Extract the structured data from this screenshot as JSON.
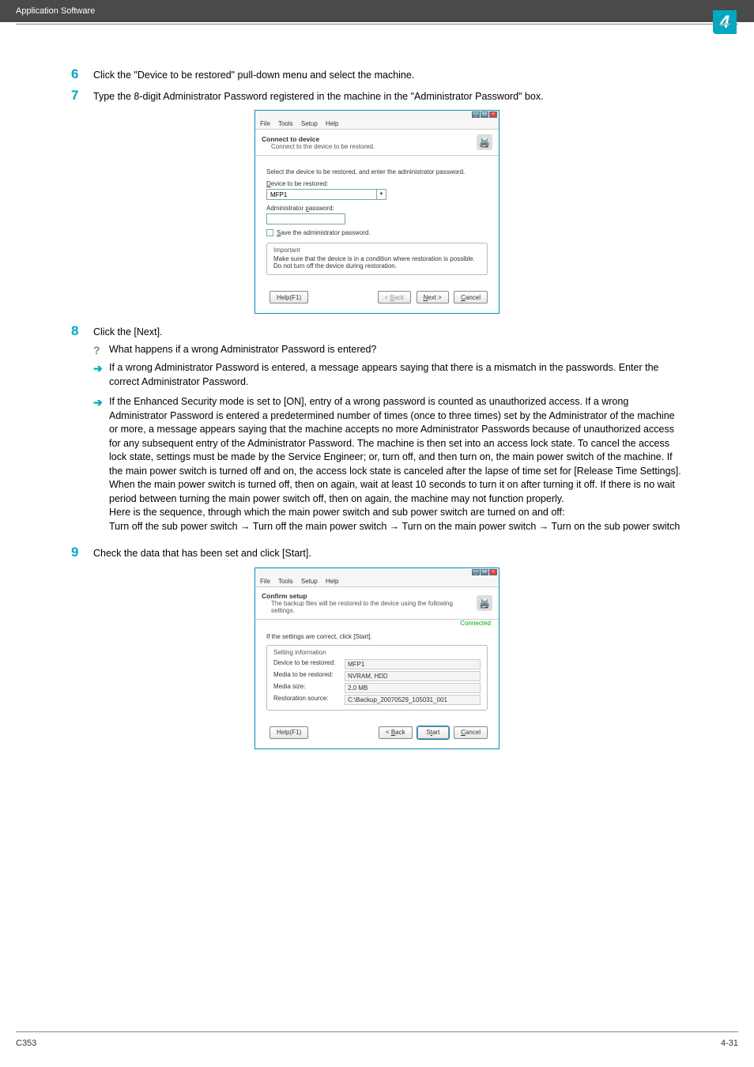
{
  "header": {
    "breadcrumb": "Application Software",
    "chapter_number": "4"
  },
  "steps": {
    "s6": {
      "num": "6",
      "text": "Click the \"Device to be restored\" pull-down menu and select the machine."
    },
    "s7": {
      "num": "7",
      "text": "Type the 8-digit Administrator Password registered in the machine in the \"Administrator Password\" box."
    },
    "s8": {
      "num": "8",
      "text": "Click the [Next]."
    },
    "s8_q": "What happens if a wrong Administrator Password is entered?",
    "s8_a1": "If a wrong Administrator Password is entered, a message appears saying that there is a mismatch in the passwords. Enter the correct Administrator Password.",
    "s8_a2": "If the Enhanced Security mode is set to [ON], entry of a wrong password is counted as unauthorized access. If a wrong Administrator Password is entered a predetermined number of times (once to three times) set by the Administrator of the machine or more, a message appears saying that the machine accepts no more Administrator Passwords because of unauthorized access for any subsequent entry of the Administrator Password. The machine is then set into an access lock state. To cancel the access lock state, settings must be made by the Service Engineer; or, turn off, and then turn on, the main power switch of the machine. If the main power switch is turned off and on, the access lock state is canceled after the lapse of time set for [Release Time Settings]. When the main power switch is turned off, then on again, wait at least 10 seconds to turn it on after turning it off. If there is no wait period between turning the main power switch off, then on again, the machine may not function properly.",
    "s8_seq1": "Here is the sequence, through which the main power switch and sub power switch are turned on and off:",
    "s8_seq2": "Turn off the sub power switch → Turn off the main power switch → Turn on the main power switch → Turn on the sub power switch",
    "s9": {
      "num": "9",
      "text": "Check the data that has been set and click [Start]."
    }
  },
  "dialog1": {
    "menu": {
      "file": "File",
      "tools": "Tools",
      "setup": "Setup",
      "help": "Help"
    },
    "title": "Connect to device",
    "subtitle": "Connect to the device to be restored.",
    "body_line": "Select the device to be restored, and enter the administrator password.",
    "label_device": "Device to be restored:",
    "device_value": "MFP1",
    "label_pw": "Administrator password:",
    "save_pw": "Save the administrator password.",
    "important_legend": "Important",
    "important_l1": "Make sure that the device is in a condition where restoration is possible.",
    "important_l2": "Do not turn off the device during restoration.",
    "btn_help": "Help(F1)",
    "btn_back": "< Back",
    "btn_next": "Next >",
    "btn_cancel": "Cancel"
  },
  "dialog2": {
    "title": "Confirm setup",
    "subtitle": "The backup files will be restored to the device using the following settings.",
    "connected": "Connected",
    "body_line": "If the settings are correct, click [Start].",
    "legend": "Setting information",
    "row1k": "Device to be restored:",
    "row1v": "MFP1",
    "row2k": "Media to be restored:",
    "row2v": "NVRAM, HDD",
    "row3k": "Media size:",
    "row3v": "2.0 MB",
    "row4k": "Restoration source:",
    "row4v": "C:\\Backup_20070529_105031_001",
    "btn_help": "Help(F1)",
    "btn_back": "< Back",
    "btn_start": "Start",
    "btn_cancel": "Cancel"
  },
  "footer": {
    "left": "C353",
    "right": "4-31"
  }
}
